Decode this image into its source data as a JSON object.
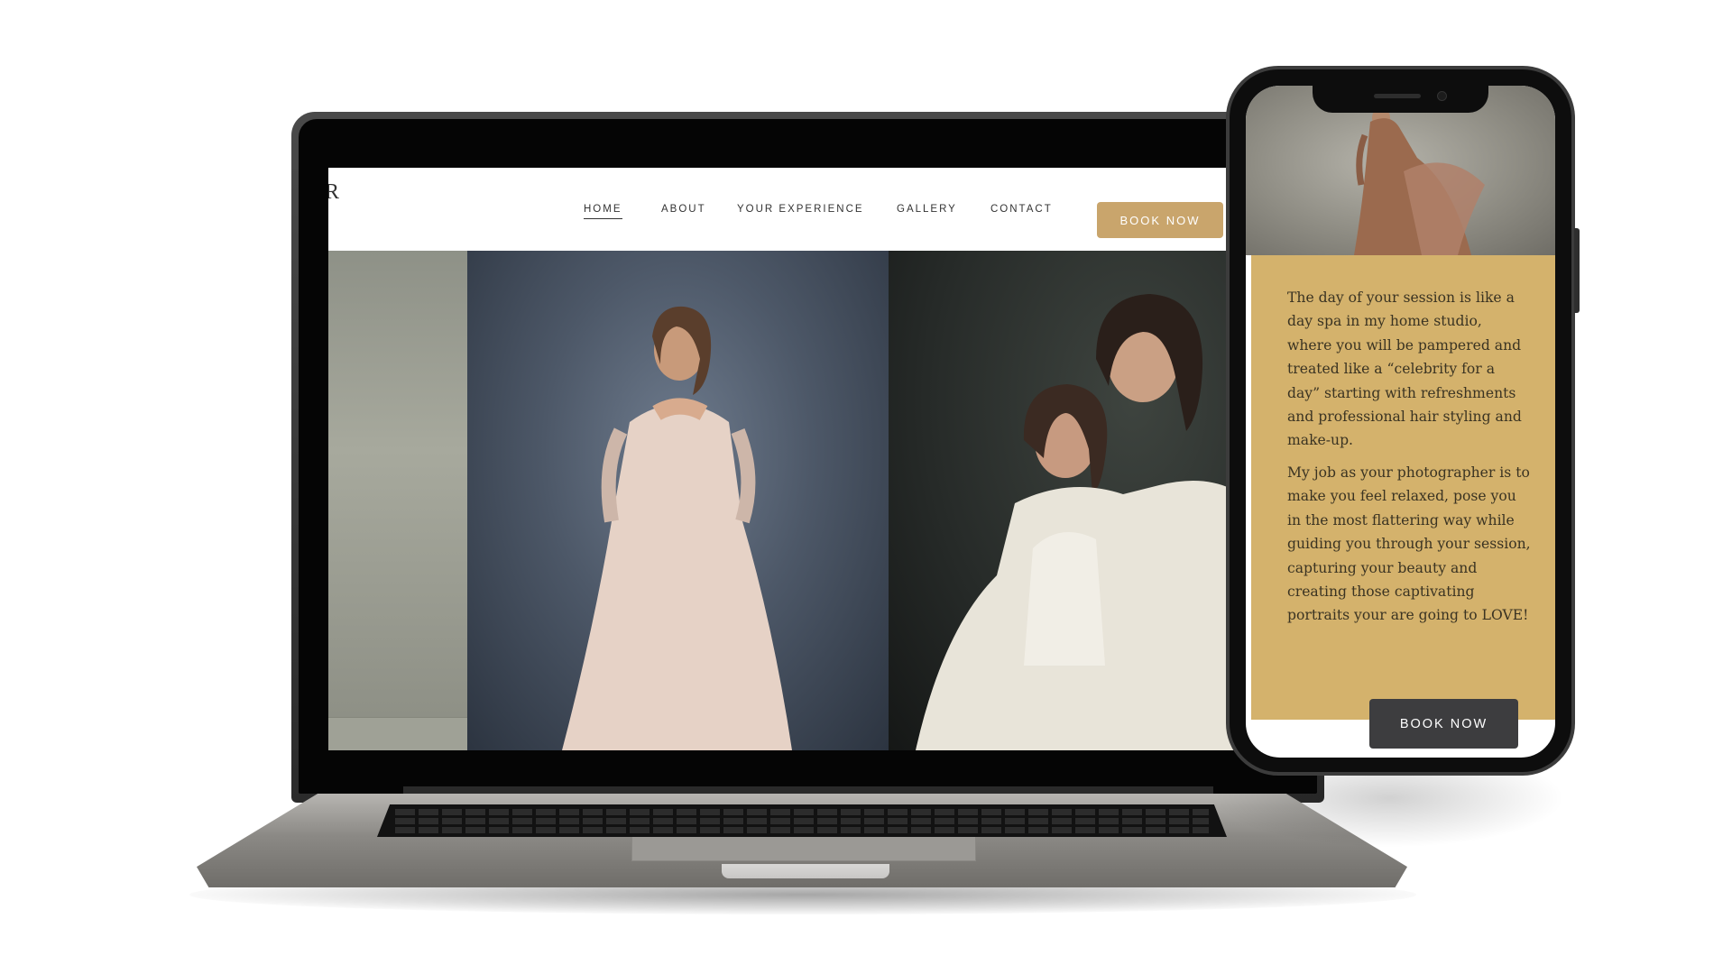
{
  "site": {
    "logo": "R"
  },
  "nav": {
    "items": [
      {
        "label": "HOME",
        "active": true
      },
      {
        "label": "ABOUT"
      },
      {
        "label": "YOUR EXPERIENCE"
      },
      {
        "label": "GALLERY"
      },
      {
        "label": "CONTACT"
      }
    ],
    "cta": "BOOK NOW"
  },
  "phone": {
    "paragraphs": [
      "The day of your session is like a day spa in my home studio, where you will be pampered and treated like a “celebrity for a day” starting with refreshments and professional hair styling and make-up.",
      "My job as your photographer is to make you feel relaxed, pose you in the most flattering way while guiding you through your session, capturing your beauty and creating those captivating portraits your are going to LOVE!"
    ],
    "cta": "BOOK NOW"
  },
  "colors": {
    "accent_gold": "#c9a56c",
    "phone_block": "#d4b26c",
    "phone_button": "#3d3d3f"
  },
  "images": {
    "hero_left": "backdrop-photo",
    "hero_center": "maternity-portrait",
    "hero_right": "mother-daughter-portrait",
    "phone_hero": "gown-portrait"
  }
}
